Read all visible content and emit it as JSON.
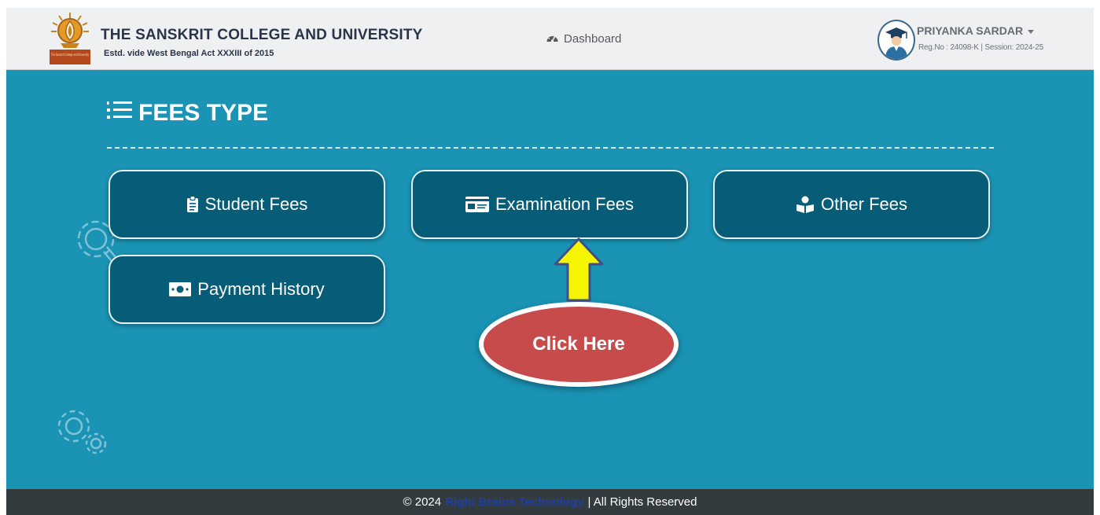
{
  "header": {
    "college_name": "THE SANSKRIT COLLEGE AND UNIVERSITY",
    "estd": "Estd. vide West Bengal Act XXXIII of 2015",
    "logo_text": "The Sanskrit College and University",
    "dashboard_label": "Dashboard",
    "user": {
      "name": "PRIYANKA SARDAR",
      "info": "Reg.No : 24098-K | Session: 2024-25"
    }
  },
  "main": {
    "title": "FEES TYPE",
    "buttons": [
      {
        "label": "Student Fees",
        "icon": "clipboard-icon"
      },
      {
        "label": "Examination Fees",
        "icon": "id-card-icon"
      },
      {
        "label": "Other Fees",
        "icon": "reader-icon"
      },
      {
        "label": "Payment History",
        "icon": "money-bill-icon"
      }
    ],
    "callout": "Click Here"
  },
  "footer": {
    "copyright": "© 2024",
    "brand": "Right Brains Technology",
    "rights": "| All Rights Reserved"
  },
  "colors": {
    "background": "#1a93b4",
    "card": "#075d78",
    "callout": "#c84b4b",
    "arrow": "#f5f500",
    "footer": "#343b3f",
    "brand": "#1d3fa3"
  }
}
